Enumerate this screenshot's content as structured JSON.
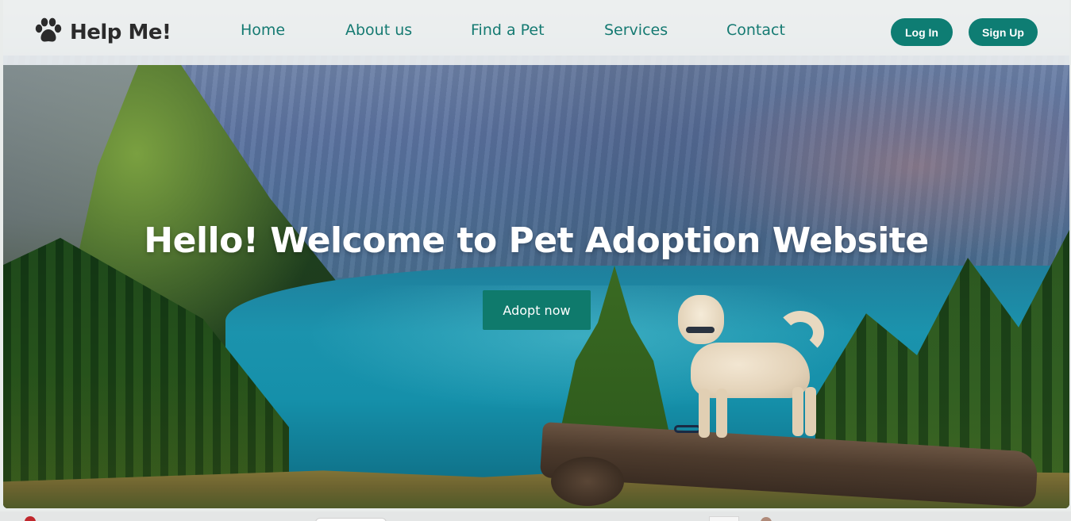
{
  "brand": {
    "icon": "paw-icon",
    "name": "Help Me!"
  },
  "nav": {
    "items": [
      {
        "label": "Home"
      },
      {
        "label": "About us"
      },
      {
        "label": "Find a Pet"
      },
      {
        "label": "Services"
      },
      {
        "label": "Contact"
      }
    ],
    "login_label": "Log In",
    "signup_label": "Sign Up"
  },
  "hero": {
    "title": "Hello! Welcome to Pet Adoption Website",
    "cta_label": "Adopt now",
    "image": "hero-photo: dog standing on a log overlooking a mountain lake"
  },
  "colors": {
    "accent": "#0e7d73",
    "nav_link": "#157a72",
    "brand_text": "#2b2b2b"
  }
}
